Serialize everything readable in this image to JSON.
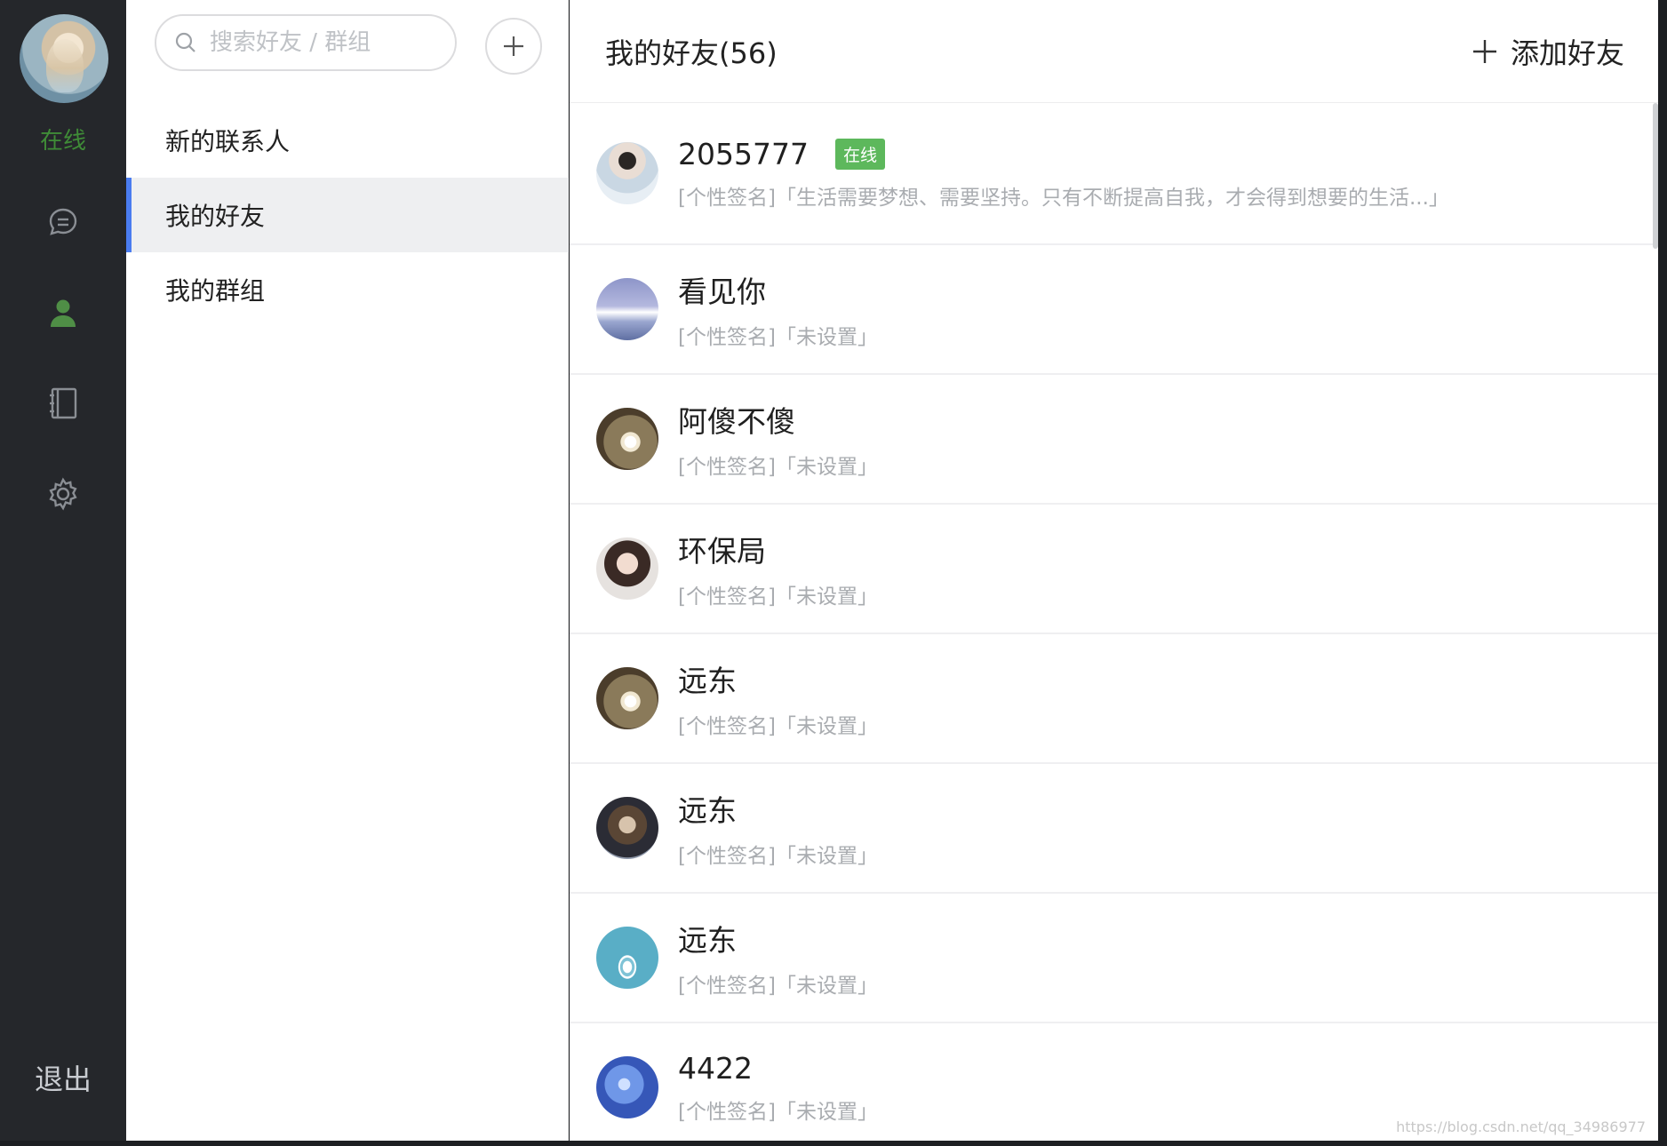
{
  "rail": {
    "status": "在线",
    "logout": "退出"
  },
  "sidebar": {
    "search_placeholder": "搜索好友 / 群组",
    "items": [
      {
        "label": "新的联系人"
      },
      {
        "label": "我的好友"
      },
      {
        "label": "我的群组"
      }
    ]
  },
  "main": {
    "title": "我的好友(56)",
    "add_friend": "添加好友",
    "friends": [
      {
        "name": "2055777",
        "badge": "在线",
        "signature": "[个性签名]「生活需要梦想、需要坚持。只有不断提高自我，才会得到想要的生活...」"
      },
      {
        "name": "看见你",
        "signature": "[个性签名]「未设置」"
      },
      {
        "name": "阿傻不傻",
        "signature": "[个性签名]「未设置」"
      },
      {
        "name": "环保局",
        "signature": "[个性签名]「未设置」"
      },
      {
        "name": "远东",
        "signature": "[个性签名]「未设置」"
      },
      {
        "name": "远东",
        "signature": "[个性签名]「未设置」"
      },
      {
        "name": "远东",
        "signature": "[个性签名]「未设置」"
      },
      {
        "name": "4422",
        "signature": "[个性签名]「未设置」"
      }
    ]
  },
  "watermark": "https://blog.csdn.net/qq_34986977",
  "colors": {
    "rail_bg": "#25272b",
    "status_green": "#3f8c37",
    "active_indicator": "#4a7cf0",
    "online_badge": "#5db85c"
  }
}
